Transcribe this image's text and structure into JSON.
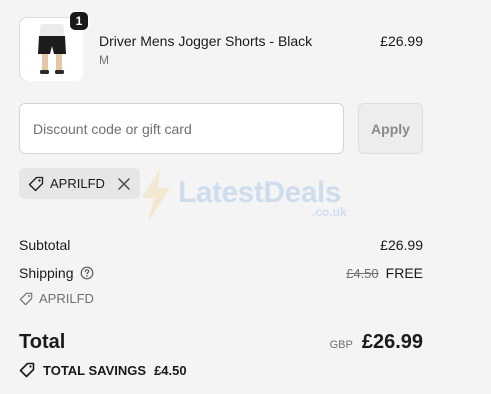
{
  "product": {
    "quantity": "1",
    "name": "Driver Mens Jogger Shorts - Black",
    "variant": "M",
    "price": "£26.99",
    "image_icon": "shorts-product-thumbnail"
  },
  "discount": {
    "placeholder": "Discount code or gift card",
    "apply_label": "Apply",
    "applied_code": "APRILFD"
  },
  "watermark": {
    "text": "LatestDeals",
    "sub": ".co.uk"
  },
  "summary": {
    "subtotal_label": "Subtotal",
    "subtotal_value": "£26.99",
    "shipping_label": "Shipping",
    "shipping_original": "£4.50",
    "shipping_value": "FREE",
    "applied_code": "APRILFD",
    "total_label": "Total",
    "currency": "GBP",
    "total_value": "£26.99",
    "savings_label": "TOTAL SAVINGS",
    "savings_value": "£4.50"
  },
  "colors": {
    "background": "#f4f4f4",
    "text": "#1a1a1a",
    "muted": "#707070",
    "watermark": "#2a7bd4"
  }
}
